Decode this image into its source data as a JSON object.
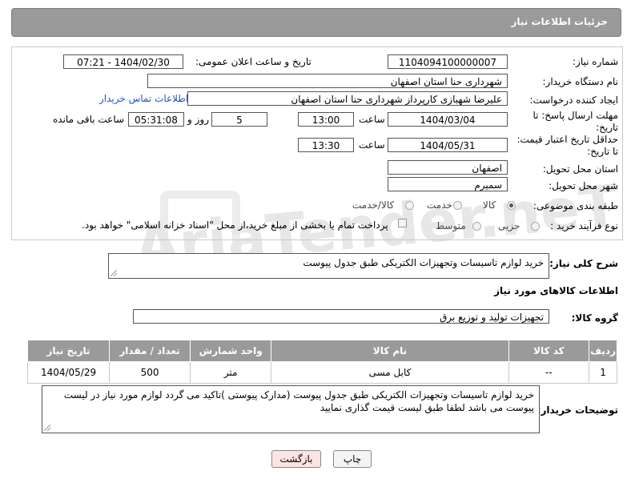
{
  "header": {
    "title": "جزئیات اطلاعات نیاز"
  },
  "form": {
    "need_number": {
      "label": "شماره نیاز:",
      "value": "1104094100000007"
    },
    "announce_datetime": {
      "label": "تاریخ و ساعت اعلان عمومی:",
      "value": "1404/02/30 - 07:21"
    },
    "buyer_org": {
      "label": "نام دستگاه خریدار:",
      "value": "شهرداری حنا استان اصفهان"
    },
    "requester": {
      "label": "ایجاد کننده درخواست:",
      "value": "علیرضا شهبازی کارپرداز شهرداری حنا استان اصفهان",
      "contact_link": "اطلاعات تماس خریدار"
    },
    "reply_deadline": {
      "label_line1": "مهلت ارسال پاسخ: تا",
      "label_line2": "تاریخ:",
      "date": "1404/03/04",
      "time_label": "ساعت",
      "time": "13:00",
      "days": "5",
      "days_label": "روز و",
      "remaining": "05:31:08",
      "remaining_label": "ساعت باقی مانده"
    },
    "price_validity": {
      "label_line1": "حداقل تاریخ اعتبار قیمت:",
      "label_line2": "تا تاریخ:",
      "date": "1404/05/31",
      "time_label": "ساعت",
      "time": "13:30"
    },
    "delivery_province": {
      "label": "استان محل تحویل:",
      "value": "اصفهان"
    },
    "delivery_city": {
      "label": "شهر محل تحویل:",
      "value": "سمیرم"
    },
    "category": {
      "label": "طبقه بندی موضوعی:",
      "options": [
        "کالا",
        "خدمت",
        "کالا/خدمت"
      ],
      "selected": "کالا"
    },
    "purchase_type": {
      "label": "نوع فرآیند خرید :",
      "options": [
        "جزیی",
        "متوسط"
      ],
      "note": "پرداخت تمام یا بخشی از مبلغ خرید،از محل \"اسناد خزانه اسلامی\" خواهد بود."
    }
  },
  "general_description": {
    "label": "شرح کلی نیاز:",
    "value": "خرید لوازم تاسیسات وتجهیزات الکتریکی طبق جدول پیوست"
  },
  "goods_section": {
    "title": "اطلاعات کالاهای مورد نیاز"
  },
  "goods_group": {
    "label": "گروه کالا:",
    "value": "تجهیزات تولید و توزیع برق"
  },
  "items_table": {
    "columns": [
      "ردیف",
      "کد کالا",
      "نام کالا",
      "واحد شمارش",
      "تعداد / مقدار",
      "تاریخ نیاز"
    ],
    "rows": [
      [
        "1",
        "--",
        "کابل مسی",
        "متر",
        "500",
        "1404/05/29"
      ]
    ]
  },
  "buyer_notes": {
    "label": "توضیحات خریدار:",
    "value": "خرید لوازم تاسیسات وتجهیزات الکتریکی طبق جدول پیوست (مدارک پیوستی )تاکید می گردد لوازم مورد نیاز در لیست پیوست می باشد لطفا طبق لیست قیمت گذاری نمایید"
  },
  "buttons": {
    "print": "چاپ",
    "back": "بازگشت"
  },
  "watermark": "AriaTender.neT"
}
